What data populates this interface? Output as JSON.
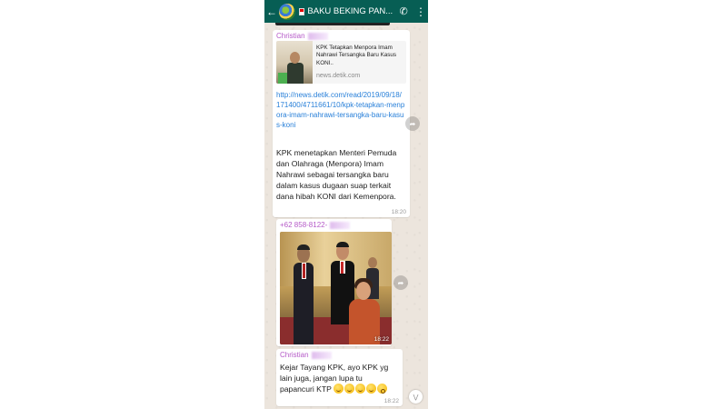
{
  "header": {
    "title": "BAKU BEKING PAN...",
    "back_icon": "arrow-left-icon",
    "call_icon": "phone-add-icon",
    "menu_icon": "more-vert-icon"
  },
  "messages": [
    {
      "sender": "Christian",
      "preview_title": "KPK Tetapkan Menpora Imam Nahrawi Tersangka Baru Kasus KONI..",
      "preview_domain": "news.detik.com",
      "link": "http://news.detik.com/read/2019/09/18/171400/4711661/10/kpk-tetapkan-menpora-imam-nahrawi-tersangka-baru-kasus-koni",
      "text": "KPK menetapkan Menteri Pemuda dan Olahraga (Menpora) Imam Nahrawi sebagai tersangka baru dalam kasus dugaan suap terkait dana hibah KONI dari Kemenpora.",
      "time": "18:20"
    },
    {
      "sender": "+62 858-8122-",
      "time": "18:22"
    },
    {
      "sender": "Christian",
      "text": "Kejar Tayang KPK, ayo KPK yg lain juga, jangan lupa tu papancuri KTP",
      "time": "18:22"
    }
  ],
  "colors": {
    "header_bg": "#075e54",
    "chat_bg": "#ece5dd",
    "sender_name": "#b55ac8",
    "link": "#2980d9"
  }
}
